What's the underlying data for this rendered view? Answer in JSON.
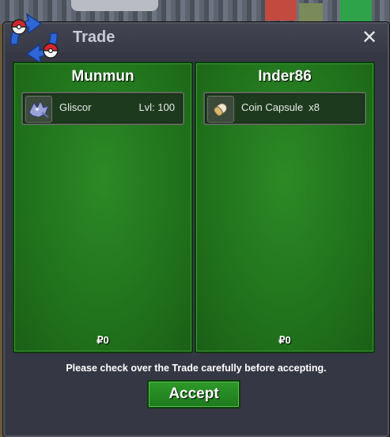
{
  "window": {
    "title": "Trade",
    "close_symbol": "✕",
    "icon": "trade-swap-pokeball-icon"
  },
  "left_panel": {
    "player_name": "Munmun",
    "item": {
      "icon": "gliscor-sprite-icon",
      "name": "Gliscor",
      "level": "Lvl: 100"
    },
    "money": "₽0"
  },
  "right_panel": {
    "player_name": "Inder86",
    "item": {
      "icon": "coin-capsule-icon",
      "name": "Coin Capsule  x8"
    },
    "money": "₽0"
  },
  "notice": "Please check over the Trade carefully before accepting.",
  "accept_label": "Accept",
  "colors": {
    "panel_green": "#1f6e1a",
    "window_bg": "#363744",
    "accept_green": "#2e9a2a"
  }
}
